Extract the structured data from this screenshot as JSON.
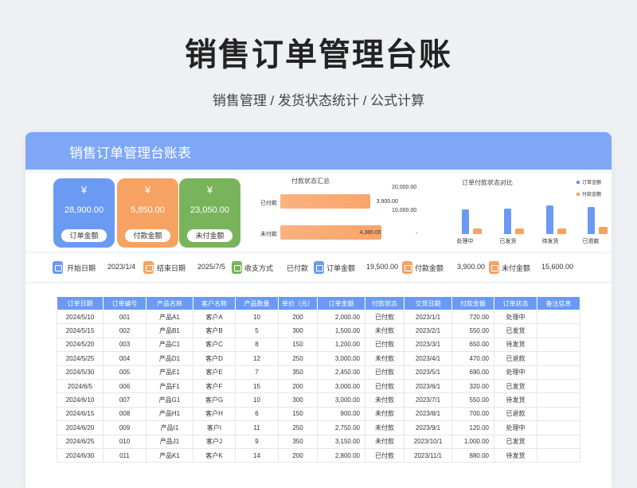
{
  "page": {
    "title": "销售订单管理台账",
    "subtitle": "销售管理 / 发货状态统计  /  公式计算"
  },
  "sheet": {
    "title": "销售订单管理台账表"
  },
  "cards": [
    {
      "symbol": "¥",
      "amount": "28,900.00",
      "label": "订单金额",
      "color": "#6b9af3"
    },
    {
      "symbol": "¥",
      "amount": "5,850.00",
      "label": "付款金额",
      "color": "#f6a263"
    },
    {
      "symbol": "¥",
      "amount": "23,050.00",
      "label": "未付金额",
      "color": "#79b45c"
    }
  ],
  "charts": {
    "payment_status": {
      "title": "付款状态汇总",
      "bar_color": "#f9a56b"
    },
    "order_vs_payment": {
      "title": "订单付款状态对比",
      "colors": {
        "order": "#6b9af3",
        "payment": "#f6a263"
      }
    }
  },
  "chart_data": [
    {
      "type": "bar",
      "orientation": "horizontal",
      "title": "付款状态汇总",
      "categories": [
        "已付款",
        "未付款"
      ],
      "values": [
        3900.0,
        4380.0
      ],
      "value_labels": [
        "3,900.00",
        "4,380.00"
      ],
      "xlim": [
        0,
        4500
      ]
    },
    {
      "type": "bar",
      "title": "订单付款状态对比",
      "categories": [
        "处理中",
        "已发货",
        "待发货",
        "已退款"
      ],
      "ylim": [
        0,
        20000
      ],
      "yticks": [
        "20,000.00",
        "10,000.00",
        "-"
      ],
      "legend_position": "top-right",
      "series": [
        {
          "name": "订单金额",
          "values": [
            10000,
            10300,
            11600,
            11000
          ]
        },
        {
          "name": "付款金额",
          "values": [
            2200,
            2200,
            2400,
            3000
          ]
        }
      ]
    }
  ],
  "filter": {
    "start_label": "开始日期",
    "start_value": "2023/1/4",
    "end_label": "结束日期",
    "end_value": "2025/7/5",
    "method_label": "收支方式",
    "method_value": "已付款",
    "order_label": "订单金额",
    "order_value": "19,500.00",
    "paid_label": "付款金额",
    "paid_value": "3,900.00",
    "unpaid_label": "未付金额",
    "unpaid_value": "15,600.00"
  },
  "table": {
    "headers": [
      "订单日期",
      "订单编号",
      "产品名称",
      "客户名称",
      "产品数量",
      "单价（元）",
      "订单金额",
      "付款状态",
      "交货日期",
      "付款金额",
      "订单状态",
      "备注信息"
    ],
    "rows": [
      [
        "2024/5/10",
        "001",
        "产品A1",
        "客户A",
        "10",
        "200",
        "2,000.00",
        "已付款",
        "2023/1/1",
        "720.00",
        "处理中",
        ""
      ],
      [
        "2024/5/15",
        "002",
        "产品B1",
        "客户B",
        "5",
        "300",
        "1,500.00",
        "未付款",
        "2023/2/1",
        "550.00",
        "已发货",
        ""
      ],
      [
        "2024/5/20",
        "003",
        "产品C1",
        "客户C",
        "8",
        "150",
        "1,200.00",
        "已付款",
        "2023/3/1",
        "650.00",
        "待发货",
        ""
      ],
      [
        "2024/5/25",
        "004",
        "产品D1",
        "客户D",
        "12",
        "250",
        "3,000.00",
        "未付款",
        "2023/4/1",
        "470.00",
        "已退款",
        ""
      ],
      [
        "2024/5/30",
        "005",
        "产品E1",
        "客户E",
        "7",
        "350",
        "2,450.00",
        "已付款",
        "2023/5/1",
        "690.00",
        "处理中",
        ""
      ],
      [
        "2024/6/5",
        "006",
        "产品F1",
        "客户F",
        "15",
        "200",
        "3,000.00",
        "已付款",
        "2023/6/1",
        "320.00",
        "已发货",
        ""
      ],
      [
        "2024/6/10",
        "007",
        "产品G1",
        "客户G",
        "10",
        "300",
        "3,000.00",
        "未付款",
        "2023/7/1",
        "550.00",
        "待发货",
        ""
      ],
      [
        "2024/6/15",
        "008",
        "产品H1",
        "客户H",
        "6",
        "150",
        "900.00",
        "未付款",
        "2023/8/1",
        "700.00",
        "已退款",
        ""
      ],
      [
        "2024/6/20",
        "009",
        "产品I1",
        "客户I",
        "11",
        "250",
        "2,750.00",
        "未付款",
        "2023/9/1",
        "120.00",
        "处理中",
        ""
      ],
      [
        "2024/6/25",
        "010",
        "产品J1",
        "客户J",
        "9",
        "350",
        "3,150.00",
        "未付款",
        "2023/10/1",
        "1,000.00",
        "已发货",
        ""
      ],
      [
        "2024/6/30",
        "011",
        "产品K1",
        "客户K",
        "14",
        "200",
        "2,800.00",
        "已付款",
        "2023/11/1",
        "880.00",
        "待发货",
        ""
      ]
    ]
  }
}
